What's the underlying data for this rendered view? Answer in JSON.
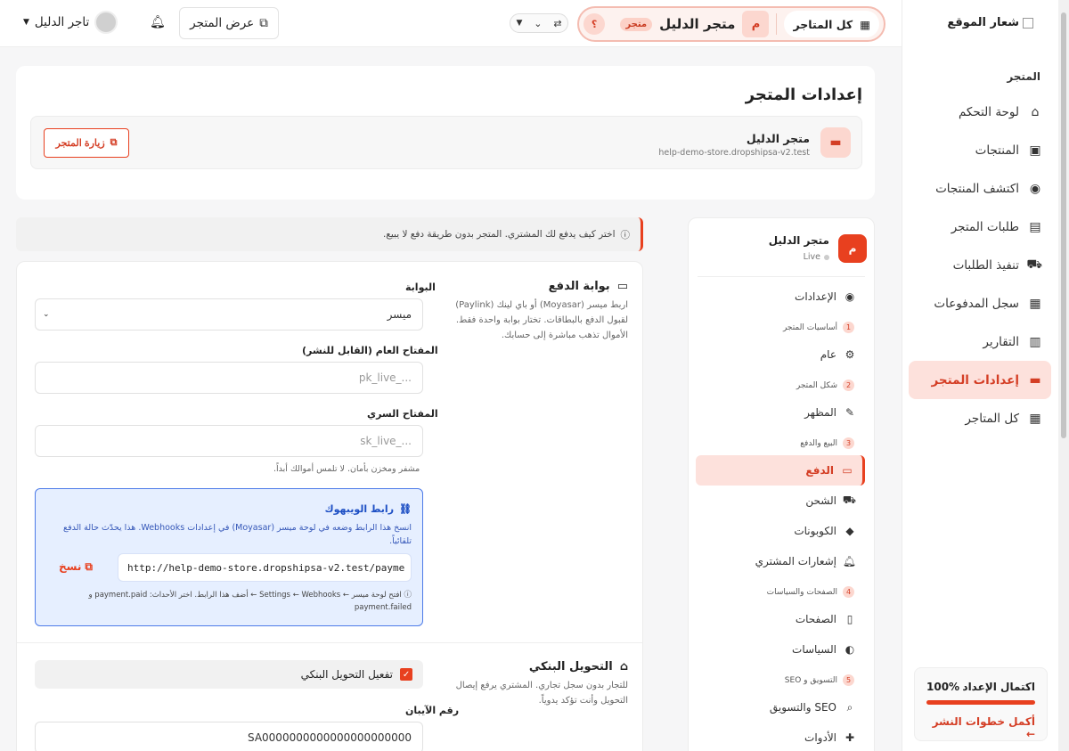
{
  "sidebar": {
    "logo": "شعار الموقع",
    "group": "المتجر",
    "items": [
      {
        "label": "لوحة التحكم",
        "icon": "home-icon"
      },
      {
        "label": "المنتجات",
        "icon": "box-icon"
      },
      {
        "label": "اكتشف المنتجات",
        "icon": "compass-icon"
      },
      {
        "label": "طلبات المتجر",
        "icon": "receipt-icon"
      },
      {
        "label": "تنفيذ الطلبات",
        "icon": "truck-icon"
      },
      {
        "label": "سجل المدفوعات",
        "icon": "money-icon"
      },
      {
        "label": "التقارير",
        "icon": "chart-icon"
      },
      {
        "label": "إعدادات المتجر",
        "icon": "store-icon",
        "active": true
      },
      {
        "label": "كل المتاجر",
        "icon": "grid-icon"
      }
    ],
    "setup": {
      "label": "اكتمال الإعداد",
      "value": "100%",
      "progress": 1.0,
      "link": "أكمل خطوات النشر ←"
    }
  },
  "topbar": {
    "all_stores": "كل المتاجر",
    "store_initial": "م",
    "store_name": "متجر الدليل",
    "store_badge": "متجر",
    "help": "؟",
    "view_store": "عرض المتجر",
    "user_name": "تاجر الدليل"
  },
  "header": {
    "title": "إعدادات المتجر",
    "store_name": "متجر الدليل",
    "store_url": "help-demo-store.dropshipsa-v2.test",
    "visit_button": "زيارة المتجر"
  },
  "settings_nav": {
    "store_initial": "م",
    "store_name": "متجر الدليل",
    "status": "Live",
    "settings": "الإعدادات",
    "s1": {
      "num": "1",
      "label": "أساسيات المتجر"
    },
    "general": "عام",
    "s2": {
      "num": "2",
      "label": "شكل المتجر"
    },
    "appearance": "المظهر",
    "s3": {
      "num": "3",
      "label": "البيع والدفع"
    },
    "payment": "الدفع",
    "shipping": "الشحن",
    "coupons": "الكوبونات",
    "notifications": "إشعارات المشتري",
    "s4": {
      "num": "4",
      "label": "الصفحات والسياسات"
    },
    "pages": "الصفحات",
    "policies": "السياسات",
    "s5": {
      "num": "5",
      "label": "التسويق و SEO"
    },
    "seo": "SEO والتسويق",
    "tools": "الأدوات"
  },
  "notice": "اختر كيف يدفع لك المشتري. المتجر بدون طريقة دفع لا يبيع.",
  "gateway": {
    "title": "بوابة الدفع",
    "desc": "اربط ميسر (Moyasar) أو باي لينك (Paylink) لقبول الدفع بالبطاقات. تختار بوابة واحدة فقط. الأموال تذهب مباشرة إلى حسابك.",
    "gateway_label": "البوابة",
    "gateway_value": "ميسر",
    "public_key_label": "المفتاح العام (القابل للنشر)",
    "public_key_placeholder": "pk_live_...",
    "secret_key_label": "المفتاح السري",
    "secret_key_placeholder": "sk_live_...",
    "secret_hint": "مشفر ومخزن بأمان. لا تلمس أموالك أبداً."
  },
  "webhook": {
    "title": "رابط الويبهوك",
    "desc": "انسخ هذا الرابط وضعه في لوحة ميسر (Moyasar) في إعدادات Webhooks. هذا يحدّث حالة الدفع تلقائياً.",
    "url": "http://help-demo-store.dropshipsa-v2.test/payme",
    "copy": "نسخ",
    "foot": "افتح لوحة ميسر ← Settings ← Webhooks ← أضف هذا الرابط. اختر الأحداث: payment.paid و payment.failed"
  },
  "bank": {
    "title": "التحويل البنكي",
    "desc": "للتجار بدون سجل تجاري. المشتري يرفع إيصال التحويل وأنت تؤكد يدوياً.",
    "enable_label": "تفعيل التحويل البنكي",
    "iban_label": "رقم الآيبان",
    "iban_value": "SA0000000000000000000000"
  }
}
